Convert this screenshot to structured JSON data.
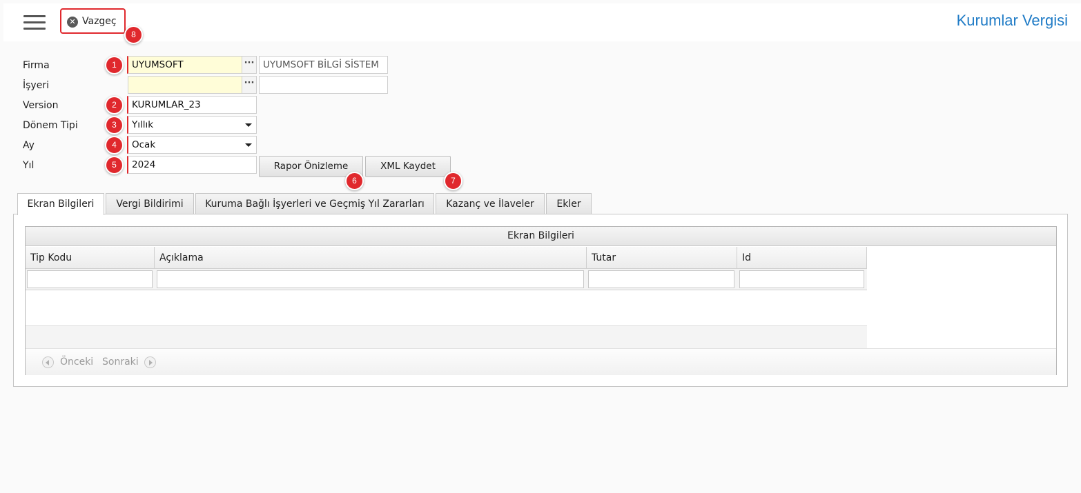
{
  "header": {
    "cancel_label": "Vazgeç",
    "title": "Kurumlar Vergisi"
  },
  "markers": [
    "1",
    "2",
    "3",
    "4",
    "5",
    "6",
    "7",
    "8"
  ],
  "form": {
    "firma": {
      "label": "Firma",
      "code": "UYUMSOFT",
      "name": "UYUMSOFT BİLGİ SİSTEM"
    },
    "isyeri": {
      "label": "İşyeri",
      "code": "",
      "name": ""
    },
    "version": {
      "label": "Version",
      "value": "KURUMLAR_23"
    },
    "donem_tipi": {
      "label": "Dönem Tipi",
      "value": "Yıllık"
    },
    "ay": {
      "label": "Ay",
      "value": "Ocak"
    },
    "yil": {
      "label": "Yıl",
      "value": "2024"
    },
    "lookup_button": "···"
  },
  "buttons": {
    "preview": "Rapor Önizleme",
    "xml_save": "XML Kaydet"
  },
  "tabs": [
    {
      "label": "Ekran Bilgileri",
      "active": true
    },
    {
      "label": "Vergi Bildirimi",
      "active": false
    },
    {
      "label": "Kuruma Bağlı İşyerleri ve Geçmiş Yıl Zararları",
      "active": false
    },
    {
      "label": "Kazanç ve İlaveler",
      "active": false
    },
    {
      "label": "Ekler",
      "active": false
    }
  ],
  "grid": {
    "title": "Ekran Bilgileri",
    "columns": [
      "Tip Kodu",
      "Açıklama",
      "Tutar",
      "Id"
    ],
    "rows": [],
    "pager": {
      "prev": "Önceki",
      "next": "Sonraki"
    }
  },
  "colors": {
    "accent": "#1f7bc6",
    "marker": "#e0282d",
    "required_field": "#fffdd8"
  }
}
